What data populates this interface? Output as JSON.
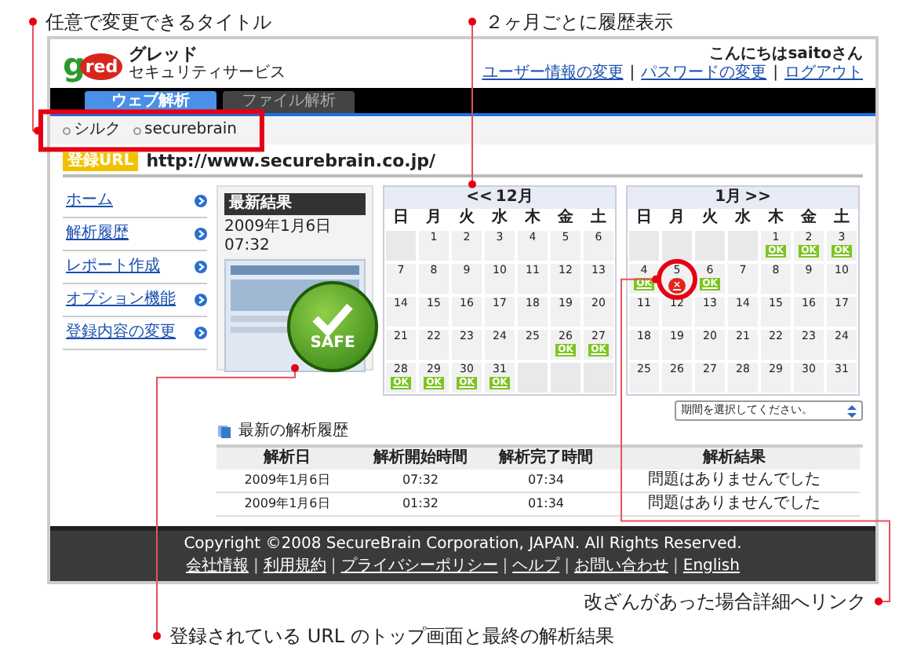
{
  "annotations": [
    {
      "text": "任意で変更できるタイトル",
      "kind": "breadcrumb"
    },
    {
      "text": "２ヶ月ごとに履歴表示",
      "kind": "calendar"
    },
    {
      "text": "改ざんがあった場合詳細へリンク",
      "kind": "alert"
    },
    {
      "text": "登録されている URL のトップ画面と最終の解析結果",
      "kind": "result"
    }
  ],
  "header": {
    "logo": [
      "g",
      "red"
    ],
    "brand": "グレッド",
    "subtitle": "セキュリティサービス",
    "greeting": "こんにちはsaitoさん",
    "links": [
      {
        "kind": "link",
        "text": "ユーザー情報の変更"
      },
      {
        "kind": "separator",
        "text": "|"
      },
      {
        "kind": "link",
        "text": "パスワードの変更"
      },
      {
        "kind": "separator",
        "text": "|"
      },
      {
        "kind": "link",
        "text": "ログアウト"
      }
    ]
  },
  "tabs": [
    {
      "label": "ウェブ解析",
      "selected": true
    },
    {
      "label": "ファイル解析",
      "selected": false
    }
  ],
  "breadcrumb": [
    "シルク",
    "securebrain"
  ],
  "site": {
    "badge": "登録URL",
    "url": "http://www.securebrain.co.jp/"
  },
  "nav": [
    "ホーム",
    "解析履歴",
    "レポート作成",
    "オプション機能",
    "登録内容の変更"
  ],
  "latest": {
    "title": "最新結果",
    "time": "2009年1月6日 07:32",
    "status": "SAFE"
  },
  "calendars": [
    {
      "prev_link": "<<",
      "month": "12月",
      "weekdays": [
        "日",
        "月",
        "火",
        "水",
        "木",
        "金",
        "土"
      ],
      "weeks": [
        [
          {
            "kind": "empty"
          },
          {
            "kind": "day",
            "day": "1"
          },
          {
            "kind": "day",
            "day": "2"
          },
          {
            "kind": "day",
            "day": "3"
          },
          {
            "kind": "day",
            "day": "4"
          },
          {
            "kind": "day",
            "day": "5"
          },
          {
            "kind": "day",
            "day": "6"
          }
        ],
        [
          {
            "kind": "day",
            "day": "7"
          },
          {
            "kind": "day",
            "day": "8"
          },
          {
            "kind": "day",
            "day": "9"
          },
          {
            "kind": "day",
            "day": "10"
          },
          {
            "kind": "day",
            "day": "11"
          },
          {
            "kind": "day",
            "day": "12"
          },
          {
            "kind": "day",
            "day": "13"
          }
        ],
        [
          {
            "kind": "day",
            "day": "14"
          },
          {
            "kind": "day",
            "day": "15"
          },
          {
            "kind": "day",
            "day": "16"
          },
          {
            "kind": "day",
            "day": "17"
          },
          {
            "kind": "day",
            "day": "18"
          },
          {
            "kind": "day",
            "day": "19"
          },
          {
            "kind": "day",
            "day": "20"
          }
        ],
        [
          {
            "kind": "day",
            "day": "21"
          },
          {
            "kind": "day",
            "day": "22"
          },
          {
            "kind": "day",
            "day": "23"
          },
          {
            "kind": "day",
            "day": "24"
          },
          {
            "kind": "day",
            "day": "25"
          },
          {
            "kind": "day",
            "day": "26",
            "badge": {
              "kind": "ok",
              "text": "OK"
            }
          },
          {
            "kind": "day",
            "day": "27",
            "badge": {
              "kind": "ok",
              "text": "OK"
            }
          }
        ],
        [
          {
            "kind": "day",
            "day": "28",
            "badge": {
              "kind": "ok",
              "text": "OK"
            }
          },
          {
            "kind": "day",
            "day": "29",
            "badge": {
              "kind": "ok",
              "text": "OK"
            }
          },
          {
            "kind": "day",
            "day": "30",
            "badge": {
              "kind": "ok",
              "text": "OK"
            }
          },
          {
            "kind": "day",
            "day": "31",
            "badge": {
              "kind": "ok",
              "text": "OK"
            }
          },
          {
            "kind": "empty"
          },
          {
            "kind": "empty"
          },
          {
            "kind": "empty"
          }
        ]
      ]
    },
    {
      "month": "1月",
      "next_link": ">>",
      "weekdays": [
        "日",
        "月",
        "火",
        "水",
        "木",
        "金",
        "土"
      ],
      "weeks": [
        [
          {
            "kind": "empty"
          },
          {
            "kind": "empty"
          },
          {
            "kind": "empty"
          },
          {
            "kind": "empty"
          },
          {
            "kind": "day",
            "day": "1",
            "badge": {
              "kind": "ok",
              "text": "OK"
            }
          },
          {
            "kind": "day",
            "day": "2",
            "badge": {
              "kind": "ok",
              "text": "OK"
            }
          },
          {
            "kind": "day",
            "day": "3",
            "badge": {
              "kind": "ok",
              "text": "OK"
            }
          }
        ],
        [
          {
            "kind": "day",
            "day": "4",
            "badge": {
              "kind": "ok",
              "text": "OK"
            }
          },
          {
            "kind": "day",
            "day": "5",
            "badge": {
              "kind": "alert",
              "text": "×"
            }
          },
          {
            "kind": "day",
            "day": "6",
            "badge": {
              "kind": "ok",
              "text": "OK"
            }
          },
          {
            "kind": "day",
            "day": "7"
          },
          {
            "kind": "day",
            "day": "8"
          },
          {
            "kind": "day",
            "day": "9"
          },
          {
            "kind": "day",
            "day": "10"
          }
        ],
        [
          {
            "kind": "day",
            "day": "11"
          },
          {
            "kind": "day",
            "day": "12"
          },
          {
            "kind": "day",
            "day": "13"
          },
          {
            "kind": "day",
            "day": "14"
          },
          {
            "kind": "day",
            "day": "15"
          },
          {
            "kind": "day",
            "day": "16"
          },
          {
            "kind": "day",
            "day": "17"
          }
        ],
        [
          {
            "kind": "day",
            "day": "18"
          },
          {
            "kind": "day",
            "day": "19"
          },
          {
            "kind": "day",
            "day": "20"
          },
          {
            "kind": "day",
            "day": "21"
          },
          {
            "kind": "day",
            "day": "22"
          },
          {
            "kind": "day",
            "day": "23"
          },
          {
            "kind": "day",
            "day": "24"
          }
        ],
        [
          {
            "kind": "day",
            "day": "25"
          },
          {
            "kind": "day",
            "day": "26"
          },
          {
            "kind": "day",
            "day": "27"
          },
          {
            "kind": "day",
            "day": "28"
          },
          {
            "kind": "day",
            "day": "29"
          },
          {
            "kind": "day",
            "day": "30"
          },
          {
            "kind": "day",
            "day": "31"
          }
        ]
      ]
    }
  ],
  "period_select": {
    "value": "期間を選択してください。"
  },
  "history": {
    "title": "最新の解析履歴",
    "columns": [
      "解析日",
      "解析開始時間",
      "解析完了時間",
      "解析結果"
    ],
    "rows": [
      [
        "2009年1月6日",
        "07:32",
        "07:34",
        "問題はありませんでした"
      ],
      [
        "2009年1月6日",
        "01:32",
        "01:34",
        "問題はありませんでした"
      ]
    ]
  },
  "footer": {
    "copyright": "Copyright ©2008 SecureBrain Corporation, JAPAN. All Rights Reserved.",
    "links": [
      {
        "kind": "link",
        "text": "会社情報"
      },
      {
        "kind": "separator",
        "text": "|"
      },
      {
        "kind": "link",
        "text": "利用規約"
      },
      {
        "kind": "separator",
        "text": "|"
      },
      {
        "kind": "link",
        "text": "プライバシーポリシー"
      },
      {
        "kind": "separator",
        "text": "|"
      },
      {
        "kind": "link",
        "text": "ヘルプ"
      },
      {
        "kind": "separator",
        "text": "|"
      },
      {
        "kind": "link",
        "text": "お問い合わせ"
      },
      {
        "kind": "separator",
        "text": "|"
      },
      {
        "kind": "link",
        "text": "English"
      }
    ]
  }
}
